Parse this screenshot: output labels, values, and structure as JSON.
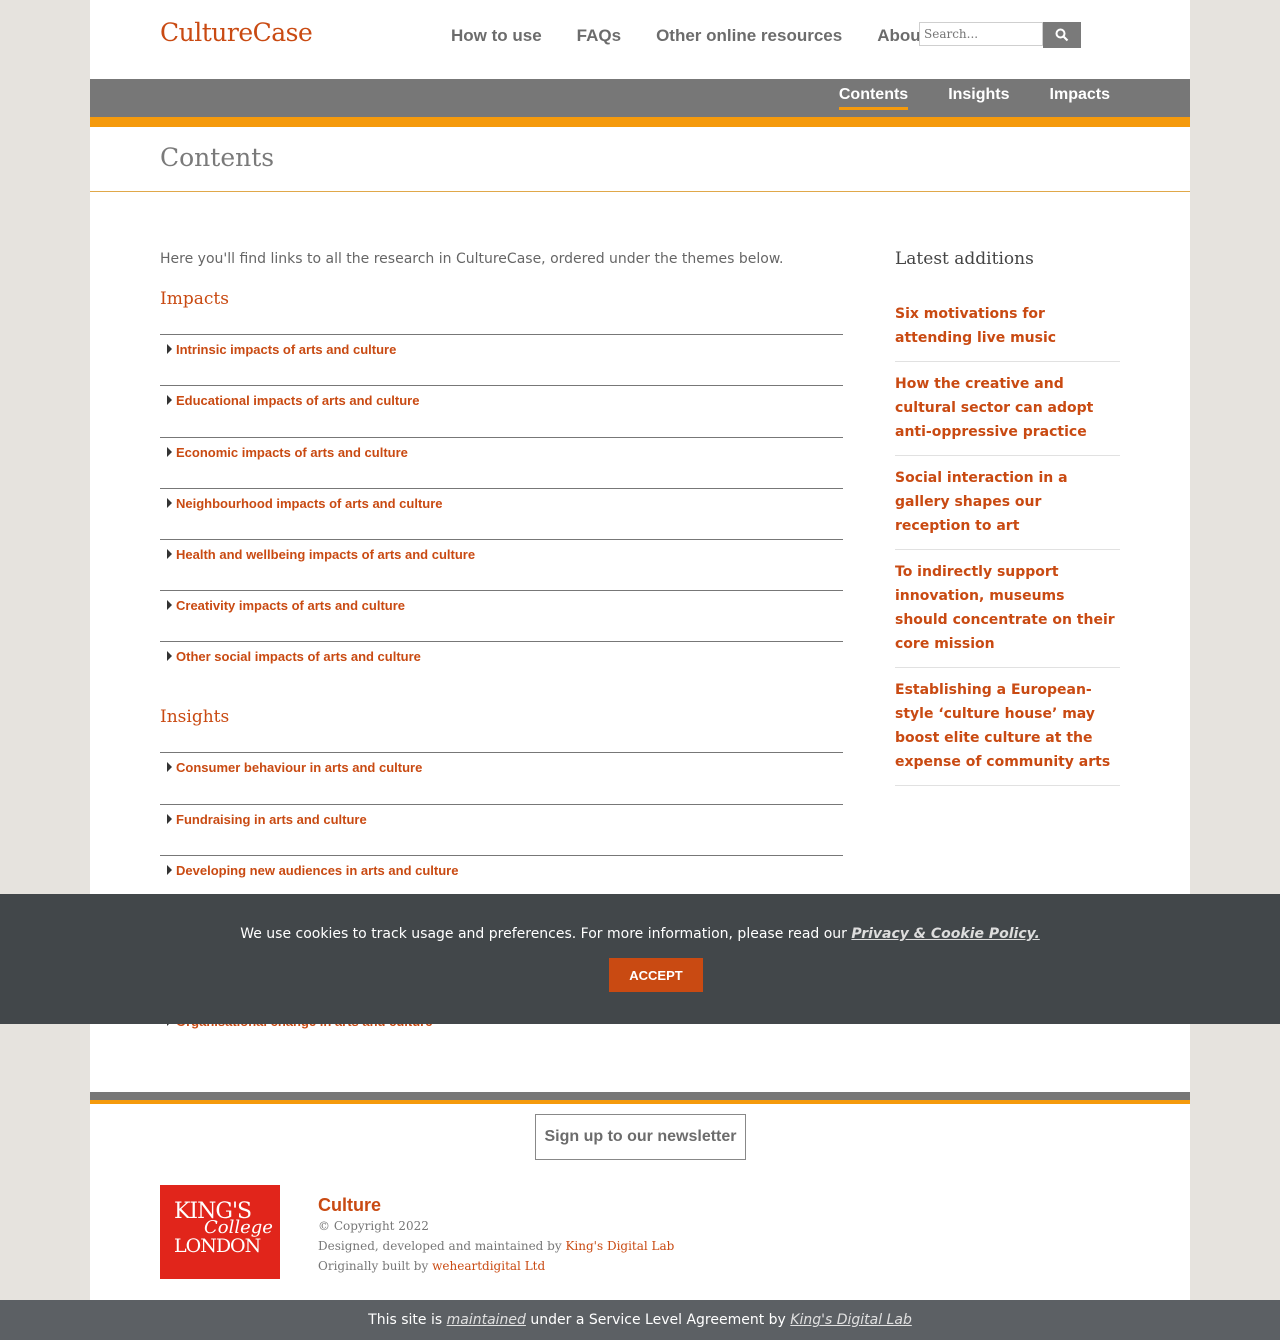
{
  "header": {
    "logo": "CultureCase",
    "nav": [
      "How to use",
      "FAQs",
      "Other online resources",
      "About us"
    ],
    "search_placeholder": "Search..."
  },
  "subnav": {
    "items": [
      "Contents",
      "Insights",
      "Impacts"
    ],
    "active": "Contents"
  },
  "page_title": "Contents",
  "intro": "Here you'll find links to all the research in CultureCase, ordered under the themes below.",
  "impacts": {
    "heading": "Impacts",
    "items": [
      "Intrinsic impacts of arts and culture",
      "Educational impacts of arts and culture",
      "Economic impacts of arts and culture",
      "Neighbourhood impacts of arts and culture",
      "Health and wellbeing impacts of arts and culture",
      "Creativity impacts of arts and culture",
      "Other social impacts of arts and culture"
    ]
  },
  "insights": {
    "heading": "Insights",
    "items": [
      "Consumer behaviour in arts and culture",
      "Fundraising in arts and culture",
      "Developing new audiences in arts and culture",
      "Organisational change in arts and culture"
    ]
  },
  "sidebar": {
    "heading": "Latest additions",
    "items": [
      "Six motivations for attending live music",
      "How the creative and cultural sector can adopt anti-oppressive practice",
      "Social interaction in a gallery shapes our reception to art",
      "To indirectly support innovation, museums should concentrate on their core mission",
      "Establishing a European-style ‘culture house’ may boost elite culture at the expense of community arts"
    ]
  },
  "cookie": {
    "text": "We use cookies to track usage and preferences. For more information, please read our",
    "link": "Privacy & Cookie Policy.",
    "accept": "ACCEPT"
  },
  "footer": {
    "newsletter": "Sign up to our newsletter",
    "kcl_logo": {
      "line1": "KING'S",
      "line2": "College",
      "line3": "LONDON"
    },
    "title": "Culture",
    "copyright": "© Copyright 2022",
    "designed_prefix": "Designed, developed and maintained by",
    "designed_link": "King's Digital Lab",
    "built_prefix": "Originally built by",
    "built_link": "weheartdigital Ltd",
    "sla_prefix": "This site is",
    "sla_link1": "maintained",
    "sla_middle": "under a Service Level Agreement by",
    "sla_link2": "King's Digital Lab"
  },
  "colors": {
    "accent": "#c94a12",
    "orange": "#f59a0c",
    "grey_nav": "#777777",
    "cookie_bg": "#42474a"
  }
}
